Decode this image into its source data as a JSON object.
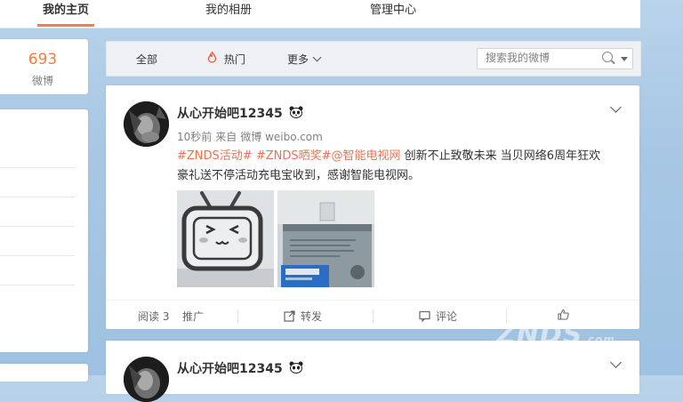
{
  "nav": {
    "tabs": [
      {
        "label": "我的主页",
        "active": true
      },
      {
        "label": "我的相册"
      },
      {
        "label": "管理中心"
      }
    ]
  },
  "profile_stats": {
    "count": "693",
    "label": "微博"
  },
  "filter": {
    "all": "全部",
    "hot": "热门",
    "more": "更多",
    "search_placeholder": "搜索我的微博"
  },
  "posts": [
    {
      "username": "从心开始吧12345",
      "time": "10秒前",
      "source_prefix": "来自",
      "source": "微博 weibo.com",
      "tags": [
        "#ZNDS活动#",
        "#ZNDS晒奖#",
        "@智能电视网"
      ],
      "text_line1": " 创新不止致敬未来 当贝网络6周年狂欢",
      "text_line2": "豪礼送不停活动充电宝收到，感谢智能电视网。",
      "actions": {
        "read": "阅读 3",
        "promote": "推广",
        "share": "转发",
        "comment": "评论",
        "like": ""
      }
    },
    {
      "username": "从心开始吧12345"
    }
  ],
  "watermark": {
    "text": "ZNDS",
    "suffix": ".com"
  },
  "colors": {
    "accent": "#fa7d3c",
    "link": "#eb7350",
    "muted": "#808080"
  }
}
